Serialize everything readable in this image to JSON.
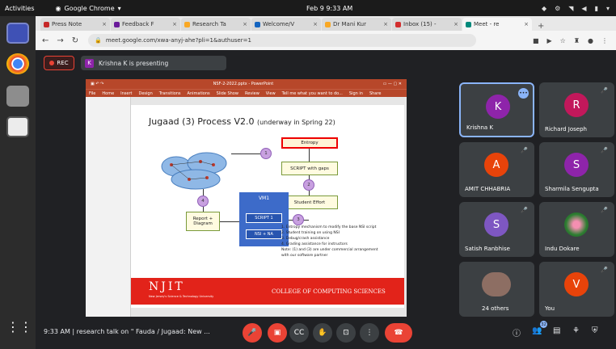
{
  "os": {
    "activities": "Activities",
    "app_name": "Google Chrome",
    "clock": "Feb 9  9:33 AM"
  },
  "tabs": [
    {
      "label": "Press Note",
      "color": "#c62828"
    },
    {
      "label": "Feedback F",
      "color": "#6a1b9a"
    },
    {
      "label": "Research Ta",
      "color": "#f9a825"
    },
    {
      "label": "Welcome/V",
      "color": "#1565c0"
    },
    {
      "label": "Dr Mani Kur",
      "color": "#f9a825"
    },
    {
      "label": "Inbox (15) -",
      "color": "#d32f2f"
    },
    {
      "label": "Meet - re",
      "color": "#00897b"
    }
  ],
  "address": {
    "url": "meet.google.com/xwa-anyj-ahe?pli=1&authuser=1"
  },
  "meet": {
    "rec_label": "REC",
    "presenter_initial": "K",
    "presenting_text": "Krishna K is presenting"
  },
  "ppt": {
    "doc_title": "NSF-2-2022.pptx - PowerPoint",
    "tell_me": "Tell me what you want to do...",
    "signin": "Sign in",
    "share": "Share",
    "ribbon": [
      "File",
      "Home",
      "Insert",
      "Design",
      "Transitions",
      "Animations",
      "Slide Show",
      "Review",
      "View"
    ]
  },
  "slide": {
    "title_main": "Jugaad (3) Process V2.0",
    "title_note": "(underway in Spring 22)",
    "entropy": "Entropy",
    "script_gaps": "SCRIPT with gaps",
    "student_effort": "Student Effort",
    "vm_label": "VM1",
    "script1": "SCRIPT 1",
    "nsi_na": "NSI + NA",
    "report": "Report +\nDiagram",
    "circles": [
      "1",
      "2",
      "3",
      "4"
    ],
    "notes": [
      "1. Entropy mechanism to modify the base NSI script",
      "2. Student training on using NSI",
      "3. Debug/crash assistance",
      "4. Grading assistance for instructors",
      "Note: (1) and (3) are under commercial arrangement with our software partner"
    ],
    "logo": "NJIT",
    "logo_sub": "New Jersey's Science & Technology University",
    "college": "COLLEGE OF COMPUTING SCIENCES"
  },
  "participants": [
    {
      "initial": "K",
      "name": "Krishna K",
      "color": "#8e24aa"
    },
    {
      "initial": "R",
      "name": "Richard Joseph",
      "color": "#c2185b"
    },
    {
      "initial": "A",
      "name": "AMIT CHHABRIA",
      "color": "#e8430a"
    },
    {
      "initial": "S",
      "name": "Sharmila Sengupta",
      "color": "#8e24aa"
    },
    {
      "initial": "S",
      "name": "Satish Ranbhise",
      "color": "#7e57c2"
    },
    {
      "initial": "",
      "name": "Indu Dokare",
      "color": "#d81b60"
    },
    {
      "initial": "",
      "name": "24 others",
      "color": "#5f6368"
    },
    {
      "initial": "V",
      "name": "You",
      "color": "#e8430a"
    }
  ],
  "bottom": {
    "time": "9:33 AM",
    "meeting_title": "research talk on \" Fauda / Jugaad: New ...",
    "people_count": "32"
  }
}
